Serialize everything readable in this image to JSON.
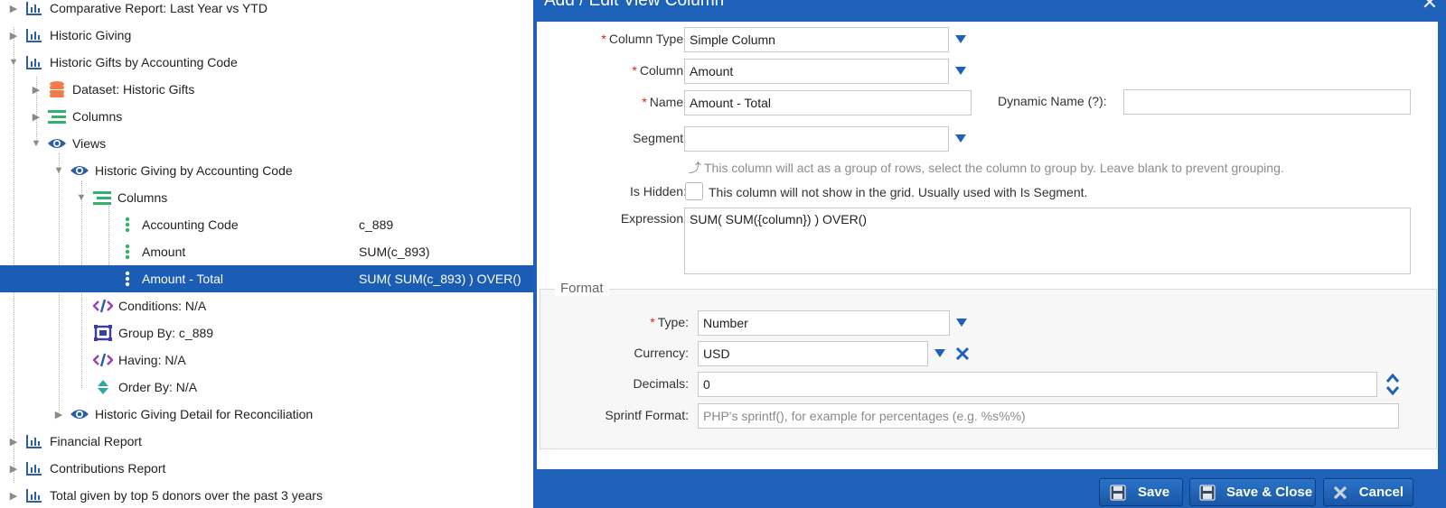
{
  "tree": {
    "items": [
      {
        "label": "Comparative Report: Last Year vs YTD",
        "icon": "bar-chart-icon"
      },
      {
        "label": "Historic Giving",
        "icon": "bar-chart-icon"
      },
      {
        "label": "Historic Gifts by Accounting Code",
        "icon": "bar-chart-icon"
      },
      {
        "label": "Dataset: Historic Gifts",
        "icon": "database-icon"
      },
      {
        "label": "Columns",
        "icon": "columns-icon"
      },
      {
        "label": "Views",
        "icon": "eye-icon"
      },
      {
        "label": "Historic Giving by Accounting Code",
        "icon": "eye-icon"
      },
      {
        "label": "Columns",
        "icon": "columns-icon"
      },
      {
        "label": "Accounting Code",
        "value": "c_889",
        "icon": "column-dots-icon"
      },
      {
        "label": "Amount",
        "value": "SUM(c_893)",
        "icon": "column-dots-icon"
      },
      {
        "label": "Amount - Total",
        "value": "SUM( SUM(c_893) ) OVER()",
        "icon": "column-dots-icon",
        "selected": true
      },
      {
        "label": "Conditions: N/A",
        "icon": "code-icon"
      },
      {
        "label": "Group By: c_889",
        "icon": "group-by-icon"
      },
      {
        "label": "Having: N/A",
        "icon": "code-icon"
      },
      {
        "label": "Order By: N/A",
        "icon": "sort-icon"
      },
      {
        "label": "Historic Giving Detail for Reconciliation",
        "icon": "eye-icon"
      },
      {
        "label": "Financial Report",
        "icon": "bar-chart-icon"
      },
      {
        "label": "Contributions Report",
        "icon": "bar-chart-icon"
      },
      {
        "label": "Total given by top 5 donors over the past 3 years",
        "icon": "bar-chart-icon"
      }
    ]
  },
  "dialog": {
    "title": "Add / Edit View Column",
    "close_icon": "close-icon",
    "fields": {
      "column_type": {
        "label": "Column Type:",
        "value": "Simple Column"
      },
      "column": {
        "label": "Column:",
        "value": "Amount"
      },
      "name": {
        "label": "Name:",
        "value": "Amount - Total"
      },
      "dynamic_name": {
        "label": "Dynamic Name (?):",
        "value": ""
      },
      "segment": {
        "label": "Segment:",
        "value": "",
        "hint": "This column will act as a group of rows, select the column to group by. Leave blank to prevent grouping."
      },
      "is_hidden": {
        "label": "Is Hidden:",
        "hint": "This column will not show in the grid. Usually used with Is Segment."
      },
      "expression": {
        "label": "Expression:",
        "value": "SUM( SUM({column}) ) OVER()"
      }
    },
    "format": {
      "legend": "Format",
      "type": {
        "label": "Type:",
        "value": "Number"
      },
      "currency": {
        "label": "Currency:",
        "value": "USD"
      },
      "decimals": {
        "label": "Decimals:",
        "value": "0"
      },
      "sprintf": {
        "label": "Sprintf Format:",
        "placeholder": "PHP's sprintf(), for example for percentages (e.g. %s%%)"
      }
    },
    "buttons": {
      "save": "Save",
      "save_close": "Save & Close",
      "cancel": "Cancel"
    }
  },
  "colors": {
    "accent": "#1d62b8",
    "selected_row": "#1b5cb5",
    "required": "#e01b1b",
    "icon_blue": "#2a5fa8",
    "icon_green": "#2fb36a",
    "icon_orange": "#f07c4a",
    "icon_purple": "#9b3fb8"
  }
}
